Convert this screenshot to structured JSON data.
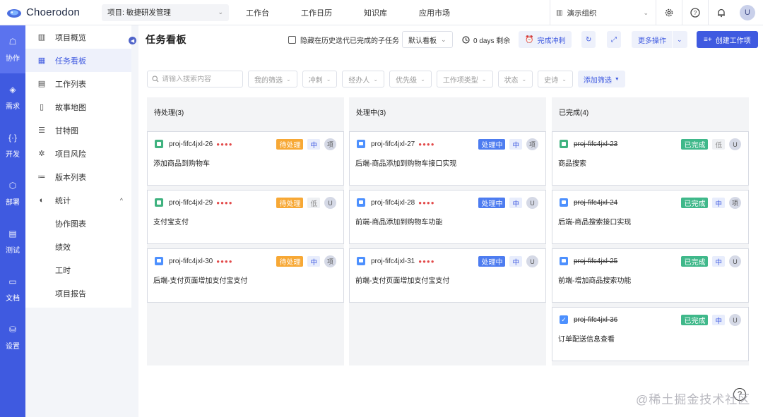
{
  "app": {
    "name": "Choerodon"
  },
  "project_select": {
    "label": "项目: 敏捷研发管理"
  },
  "topnav": [
    "工作台",
    "工作日历",
    "知识库",
    "应用市场"
  ],
  "org_select": {
    "label": "演示组织"
  },
  "user": {
    "initial": "U"
  },
  "rail": [
    {
      "label": "协作",
      "icon": "collab-icon"
    },
    {
      "label": "需求",
      "icon": "layers-icon"
    },
    {
      "label": "开发",
      "icon": "code-icon"
    },
    {
      "label": "部署",
      "icon": "deploy-icon"
    },
    {
      "label": "测试",
      "icon": "test-icon"
    },
    {
      "label": "文档",
      "icon": "doc-icon"
    },
    {
      "label": "设置",
      "icon": "settings-icon"
    }
  ],
  "sidebar": {
    "items": [
      {
        "label": "项目概览",
        "icon": "chart-icon"
      },
      {
        "label": "任务看板",
        "icon": "board-icon"
      },
      {
        "label": "工作列表",
        "icon": "list-icon"
      },
      {
        "label": "故事地图",
        "icon": "map-icon"
      },
      {
        "label": "甘特图",
        "icon": "gantt-icon"
      },
      {
        "label": "项目风险",
        "icon": "risk-icon"
      },
      {
        "label": "版本列表",
        "icon": "version-icon"
      },
      {
        "label": "统计",
        "icon": "pie-icon"
      }
    ],
    "sub_items": [
      "协作图表",
      "绩效",
      "工时",
      "项目报告"
    ]
  },
  "header": {
    "title": "任务看板",
    "hide_subtasks": "隐藏在历史迭代已完成的子任务",
    "board_select": "默认看板",
    "remaining": "0 days 剩余",
    "sprint_btn": "完成冲刺",
    "more_ops": "更多操作",
    "create_btn": "创建工作项"
  },
  "filters": {
    "search_placeholder": "请输入搜索内容",
    "items": [
      "我的筛选",
      "冲刺",
      "经办人",
      "优先级",
      "工作项类型",
      "状态",
      "史诗"
    ],
    "add_filter": "添加筛选"
  },
  "columns": [
    {
      "title": "待处理(3)",
      "cards": [
        {
          "id": "proj-fifc4jxl-26",
          "type": "story",
          "title": "添加商品到购物车",
          "status": "待处理",
          "priority": "中",
          "assignee": "项"
        },
        {
          "id": "proj-fifc4jxl-29",
          "type": "story",
          "title": "支付宝支付",
          "status": "待处理",
          "priority": "低",
          "assignee": "U"
        },
        {
          "id": "proj-fifc4jxl-30",
          "type": "task",
          "title": "后端-支付页面增加支付宝支付",
          "status": "待处理",
          "priority": "中",
          "assignee": "项"
        }
      ]
    },
    {
      "title": "处理中(3)",
      "cards": [
        {
          "id": "proj-fifc4jxl-27",
          "type": "task",
          "title": "后端-商品添加到购物车接口实现",
          "status": "处理中",
          "priority": "中",
          "assignee": "项"
        },
        {
          "id": "proj-fifc4jxl-28",
          "type": "task",
          "title": "前端-商品添加到购物车功能",
          "status": "处理中",
          "priority": "中",
          "assignee": "U"
        },
        {
          "id": "proj-fifc4jxl-31",
          "type": "task",
          "title": "前端-支付页面增加支付宝支付",
          "status": "处理中",
          "priority": "中",
          "assignee": "U"
        }
      ]
    },
    {
      "title": "已完成(4)",
      "cards": [
        {
          "id": "proj-fifc4jxl-23",
          "type": "story",
          "title": "商品搜索",
          "status": "已完成",
          "priority": "低",
          "assignee": "U"
        },
        {
          "id": "proj-fifc4jxl-24",
          "type": "task",
          "title": "后端-商品搜索接口实现",
          "status": "已完成",
          "priority": "中",
          "assignee": "项"
        },
        {
          "id": "proj-fifc4jxl-25",
          "type": "task",
          "title": "前端-增加商品搜索功能",
          "status": "已完成",
          "priority": "中",
          "assignee": "U"
        },
        {
          "id": "proj-fifc4jxl-36",
          "type": "done",
          "title": "订单配送信息查看",
          "status": "已完成",
          "priority": "中",
          "assignee": "U"
        }
      ]
    }
  ],
  "colors": {
    "primary": "#3f5ae0",
    "todo": "#f7a835",
    "doing": "#4d7cf0",
    "done": "#3fb88a"
  },
  "watermark": "@稀土掘金技术社区",
  "help": "?"
}
